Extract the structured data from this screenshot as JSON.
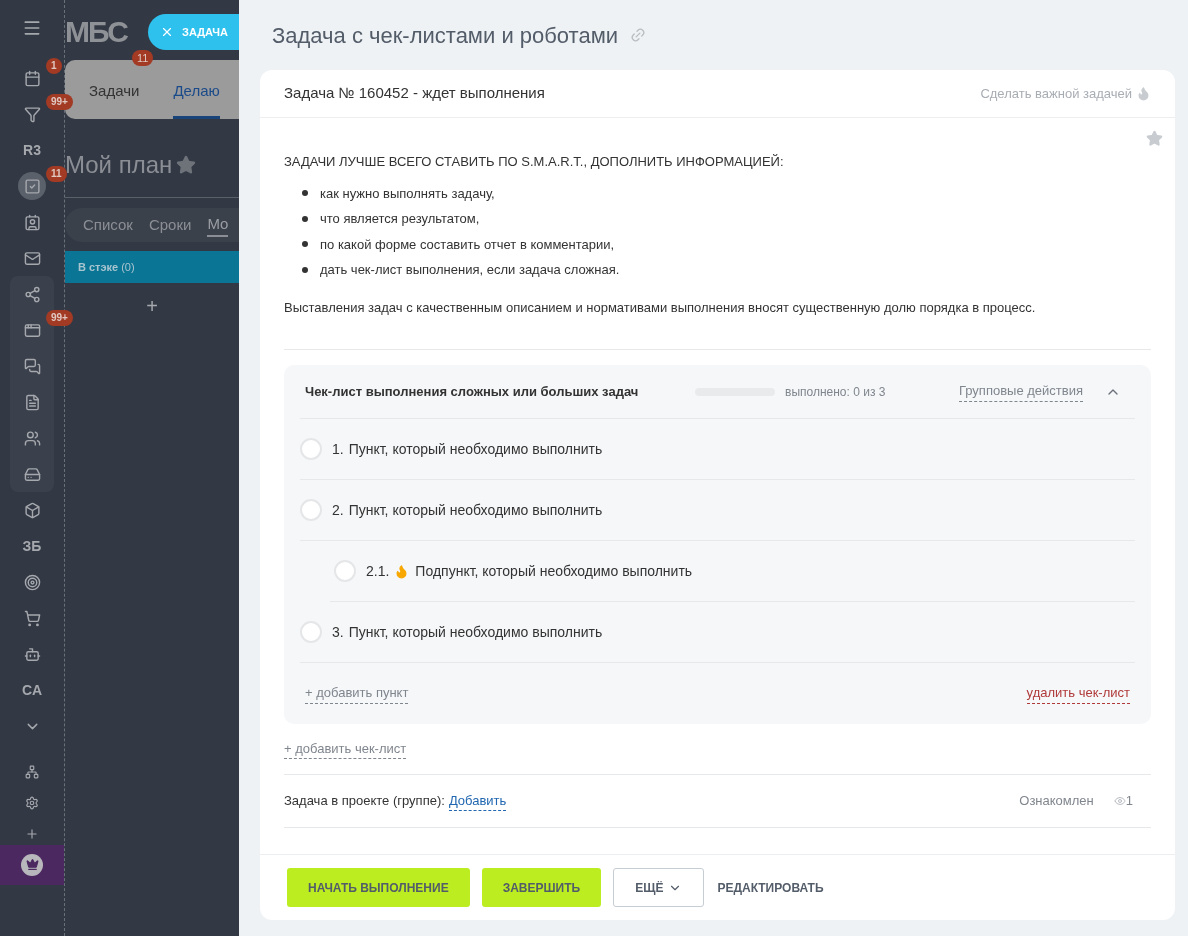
{
  "sidebar": {
    "items": [
      {
        "kind": "icon",
        "badge": "1",
        "selected": false
      },
      {
        "kind": "icon",
        "badge": "99+",
        "selected": false
      },
      {
        "kind": "text",
        "label": "R3",
        "selected": false
      },
      {
        "kind": "icon",
        "badge": "11",
        "selected": true
      },
      {
        "kind": "icon",
        "selected": false
      },
      {
        "kind": "icon",
        "selected": false
      },
      {
        "kind": "icon",
        "selected": false
      },
      {
        "kind": "icon",
        "badge": "99+",
        "selected": false
      },
      {
        "kind": "icon",
        "selected": false
      },
      {
        "kind": "icon",
        "selected": false
      },
      {
        "kind": "icon",
        "selected": false
      },
      {
        "kind": "icon",
        "selected": false
      },
      {
        "kind": "icon",
        "selected": false
      },
      {
        "kind": "text",
        "label": "ЗБ",
        "selected": false
      },
      {
        "kind": "icon",
        "selected": false
      },
      {
        "kind": "icon",
        "selected": false
      },
      {
        "kind": "icon",
        "selected": false
      },
      {
        "kind": "text",
        "label": "CA",
        "selected": false
      },
      {
        "kind": "icon",
        "selected": false
      }
    ],
    "bottom_items": [
      {
        "selected": false
      },
      {
        "selected": false
      },
      {
        "selected": false
      },
      {
        "selected": true
      }
    ]
  },
  "background": {
    "logo": "МБС",
    "tabs": [
      {
        "label": "Задачи",
        "badge": "11",
        "selected": false
      },
      {
        "label": "Делаю",
        "selected": true
      }
    ],
    "page_title": "Мой план",
    "views": [
      {
        "label": "Список",
        "selected": false
      },
      {
        "label": "Сроки",
        "selected": false
      },
      {
        "label": "Мо",
        "selected": true
      }
    ],
    "column": {
      "title": "В стэке",
      "count": "(0)",
      "add": "+"
    }
  },
  "close_chip": {
    "label": "ЗАДАЧА"
  },
  "task": {
    "title": "Задача с чек-листами и роботами",
    "header": "Задача № 160452 - ждет выполнения",
    "make_important": "Сделать важной задачей",
    "favorite": false,
    "description": {
      "heading": "ЗАДАЧИ ЛУЧШЕ ВСЕГО СТАВИТЬ ПО S.M.A.R.T., ДОПОЛНИТЬ ИНФОРМАЦИЕЙ:",
      "bullets": [
        "как нужно выполнять задачу,",
        "что является результатом,",
        "по какой форме составить отчет в комментарии,",
        "дать чек-лист выполнения, если задача сложная."
      ],
      "paragraph": "Выставления задач с качественным описанием и нормативами выполнения вносят существенную долю порядка в процесс."
    },
    "checklist": {
      "title": "Чек-лист выполнения сложных или больших задач",
      "level": 0,
      "progress": "выполнено: 0 из 3",
      "group_actions": "Групповые действия",
      "expanded": true,
      "items": [
        {
          "number": "1.",
          "text": "Пункт, который необходимо выполнить",
          "checked": false,
          "important": false
        },
        {
          "number": "2.",
          "text": "Пункт, который необходимо выполнить",
          "checked": false,
          "important": false,
          "children": [
            {
              "number": "2.1.",
              "text": "Подпункт, который необходимо выполнить",
              "checked": false,
              "important": true
            }
          ]
        },
        {
          "number": "3.",
          "text": "Пункт, который необходимо выполнить",
          "checked": false,
          "important": false
        }
      ],
      "add_item": "+ добавить пункт",
      "delete": "удалить чек-лист"
    },
    "add_checklist": "+ добавить чек-лист",
    "project": {
      "label": "Задача в проекте (группе):",
      "link": "Добавить",
      "acknowledged": "Ознакомлен",
      "views": "1"
    },
    "buttons": [
      {
        "kind": "primary",
        "label": "НАЧАТЬ ВЫПОЛНЕНИЕ"
      },
      {
        "kind": "primary",
        "label": "ЗАВЕРШИТЬ"
      },
      {
        "kind": "dropdown",
        "label": "ЕЩЁ"
      },
      {
        "kind": "text",
        "label": "РЕДАКТИРОВАТЬ"
      }
    ]
  }
}
